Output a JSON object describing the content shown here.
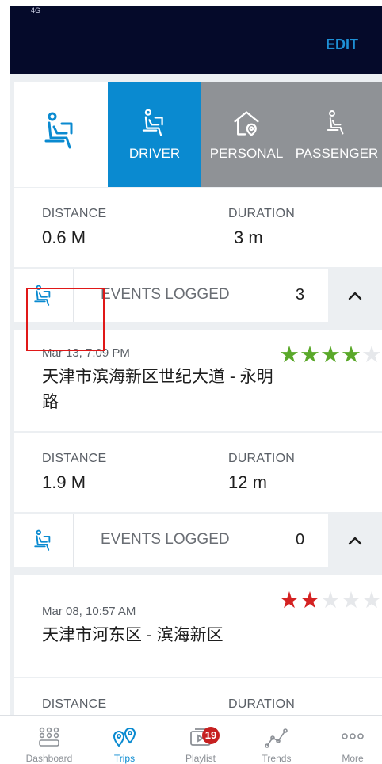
{
  "header": {
    "status_text": "4G",
    "edit_label": "EDIT"
  },
  "trip_type_selector": {
    "options": [
      {
        "label": "",
        "icon": "driver-seat-icon"
      },
      {
        "label": "DRIVER",
        "icon": "driver-seat-icon"
      },
      {
        "label": "PERSONAL",
        "icon": "home-location-icon"
      },
      {
        "label": "PASSENGER",
        "icon": "passenger-seat-icon"
      }
    ],
    "selected": "DRIVER"
  },
  "first_trip_stats": {
    "distance_label": "DISTANCE",
    "distance_value": "0.6 M",
    "duration_label": "DURATION",
    "duration_value": "3 m"
  },
  "events_1": {
    "label": "EVENTS LOGGED",
    "count": "3"
  },
  "trips": [
    {
      "date": "Mar 13, 7:09 PM",
      "title": "天津市滨海新区世纪大道 - 永明路",
      "rating": 4,
      "rating_color": "#5aa82a",
      "distance_label": "DISTANCE",
      "distance_value": "1.9 M",
      "duration_label": "DURATION",
      "duration_value": "12 m",
      "events_label": "EVENTS LOGGED",
      "events_count": "0"
    },
    {
      "date": "Mar 08, 10:57 AM",
      "title": "天津市河东区 - 滨海新区",
      "rating": 2,
      "rating_color": "#d42222",
      "distance_label": "DISTANCE",
      "duration_label": "DURATION"
    }
  ],
  "tabbar": {
    "items": [
      {
        "label": "Dashboard",
        "icon": "dashboard-icon"
      },
      {
        "label": "Trips",
        "icon": "trips-icon"
      },
      {
        "label": "Playlist",
        "icon": "playlist-icon",
        "badge": "19"
      },
      {
        "label": "Trends",
        "icon": "trends-icon"
      },
      {
        "label": "More",
        "icon": "more-icon"
      }
    ],
    "active": "Trips"
  },
  "colors": {
    "accent_blue": "#0a8ad0",
    "header_bg": "#050a2a",
    "inactive_tab_gray": "#8f9296"
  }
}
